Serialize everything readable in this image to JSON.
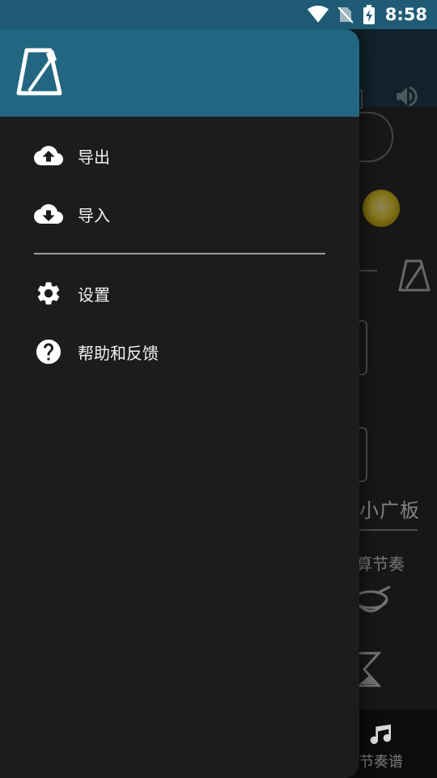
{
  "status_bar": {
    "time": "8:58",
    "icons": [
      "wifi-icon",
      "no-sim-icon",
      "battery-charging-icon"
    ],
    "background": "#1f5b75"
  },
  "drawer": {
    "header_color": "#236681",
    "logo": "metronome-logo",
    "items": [
      {
        "label": "导出",
        "icon": "cloud-upload-icon"
      },
      {
        "label": "导入",
        "icon": "cloud-download-icon"
      },
      {
        "label": "设置",
        "icon": "gear-icon"
      },
      {
        "label": "帮助和反馈",
        "icon": "help-circle-icon"
      }
    ]
  },
  "background_app": {
    "tempo_name": "小广板",
    "calc_label": "算节奏",
    "bottom_nav_label": "节奏谱",
    "accent": "#f3d93a"
  }
}
